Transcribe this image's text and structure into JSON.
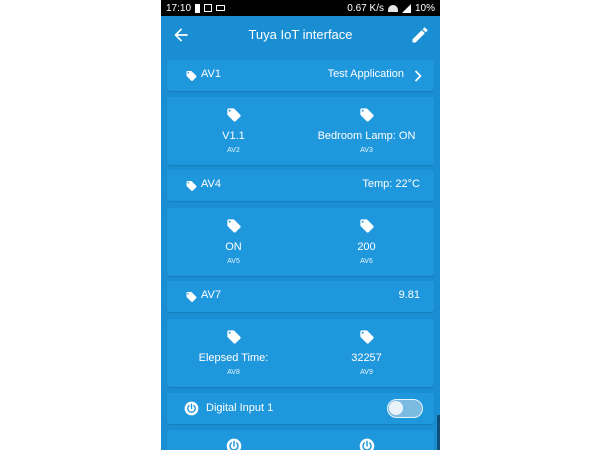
{
  "statusbar": {
    "time": "17:10",
    "net_speed": "0.67 K/s",
    "battery": "10%"
  },
  "appbar": {
    "title": "Tuya IoT interface"
  },
  "rows": {
    "av1": {
      "label": "AV1",
      "value": "Test Application"
    },
    "av2": {
      "value": "V1.1",
      "label": "AV2"
    },
    "av3": {
      "value": "Bedroom Lamp: ON",
      "label": "AV3"
    },
    "av4": {
      "label": "AV4",
      "value": "Temp: 22°C"
    },
    "av5": {
      "value": "ON",
      "label": "AV5"
    },
    "av6": {
      "value": "200",
      "label": "AV6"
    },
    "av7": {
      "label": "AV7",
      "value": "9.81"
    },
    "av8": {
      "value": "Elepsed Time:",
      "label": "AV8"
    },
    "av9": {
      "value": "32257",
      "label": "AV9"
    }
  },
  "digital_input_1": {
    "label": "Digital Input 1",
    "state": "off"
  },
  "colors": {
    "background": "#1a8ed3",
    "card": "#1f97dd",
    "statusbar": "#000000",
    "text": "#ffffff"
  },
  "icons": [
    "arrow-back-icon",
    "edit-pencil-icon",
    "tag-icon",
    "chevron-right-icon",
    "power-icon",
    "toggle-switch"
  ]
}
